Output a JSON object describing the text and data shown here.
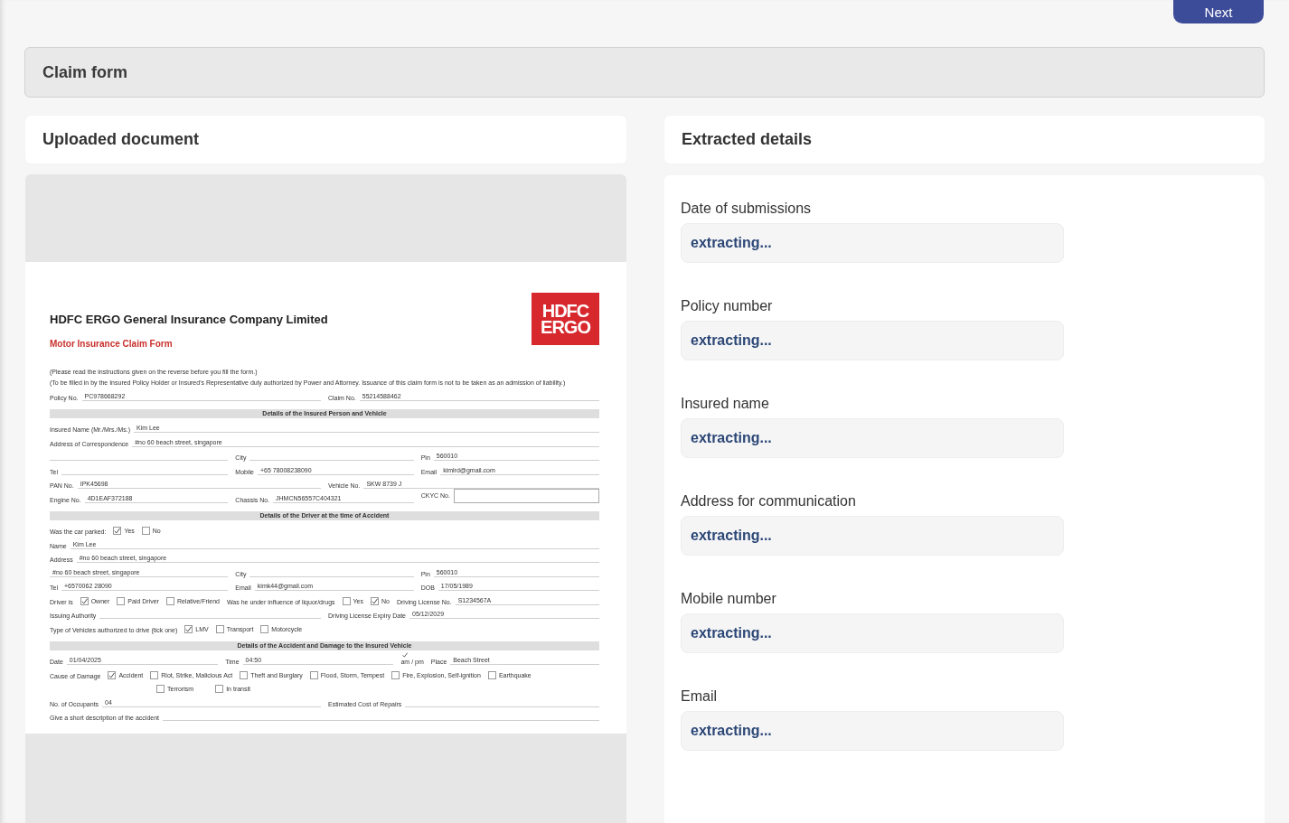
{
  "top_bar": {
    "next_button": "Next"
  },
  "claim_bar": {
    "title": "Claim form"
  },
  "left_panel": {
    "title": "Uploaded document"
  },
  "document": {
    "company": "HDFC ERGO General Insurance Company Limited",
    "logo": "HDFC ERGO",
    "form_title": "Motor Insurance Claim Form",
    "notes": [
      "(Please read the instructions given on the reverse before you fill the form.)",
      "(To be filled in by the Insured Policy Holder or Insured's Representative duly authorized by Power and Attorney. Issuance of this claim form is not to be taken as an admission of liability.)"
    ],
    "top_fields": {
      "items": [
        {
          "kind": "field",
          "label": "Policy No.",
          "value": "PC978668292"
        },
        {
          "kind": "field",
          "label": "Claim No.",
          "value": "55214588462"
        }
      ]
    },
    "sections": [
      {
        "title": "Details of the Insured Person and Vehicle",
        "lines": [
          {
            "items": [
              {
                "kind": "field",
                "label": "Insured Name (Mr./Mrs./Ms.)",
                "value": "Kim Lee"
              }
            ]
          },
          {
            "items": [
              {
                "kind": "field",
                "label": "Address of Correspondence",
                "value": "#no 60 beach street, singapore"
              }
            ]
          },
          {
            "items": [
              {
                "kind": "field"
              },
              {
                "kind": "field",
                "label": "City"
              },
              {
                "kind": "field",
                "label": "Pin",
                "value": "560010"
              }
            ]
          },
          {
            "items": [
              {
                "kind": "field",
                "label": "Tel"
              },
              {
                "kind": "field",
                "label": "Mobile",
                "value": "+65 78008238090"
              },
              {
                "kind": "field",
                "label": "Email",
                "value": "kimlrd@gmail.com"
              }
            ]
          },
          {
            "items": [
              {
                "kind": "field",
                "label": "PAN No.",
                "value": "IPK45698"
              },
              {
                "kind": "field",
                "label": "Vehicle No.",
                "value": "SKW 8739 J"
              }
            ]
          },
          {
            "items": [
              {
                "kind": "field",
                "label": "Engine No.",
                "value": "4D1EAF372188"
              },
              {
                "kind": "field",
                "label": "Chassis No.",
                "value": "JHMCN56557C404321"
              },
              {
                "kind": "box",
                "label": "CKYC No."
              }
            ]
          }
        ]
      },
      {
        "title": "Details of the Driver at the time of Accident",
        "lines": [
          {
            "items": [
              {
                "kind": "label",
                "label": "Was the car parked:"
              },
              {
                "kind": "check",
                "label": "Yes",
                "checked": true
              },
              {
                "kind": "check",
                "label": "No",
                "checked": false
              }
            ]
          },
          {
            "items": [
              {
                "kind": "field",
                "label": "Name",
                "value": "Kim Lee"
              }
            ]
          },
          {
            "items": [
              {
                "kind": "field",
                "label": "Address",
                "value": "#no 60 beach street, singapore"
              }
            ]
          },
          {
            "items": [
              {
                "kind": "field",
                "value": "#no 60 beach street, singapore"
              },
              {
                "kind": "field",
                "label": "City"
              },
              {
                "kind": "field",
                "label": "Pin",
                "value": "560010"
              }
            ]
          },
          {
            "items": [
              {
                "kind": "field",
                "label": "Tel",
                "value": "+6570062 28090"
              },
              {
                "kind": "field",
                "label": "Email",
                "value": "kimk44@gmail.com"
              },
              {
                "kind": "field",
                "label": "DOB",
                "value": "17/05/1989"
              }
            ]
          },
          {
            "items": [
              {
                "kind": "label",
                "label": "Driver is"
              },
              {
                "kind": "check",
                "label": "Owner",
                "checked": true
              },
              {
                "kind": "check",
                "label": "Paid Driver",
                "checked": false
              },
              {
                "kind": "check",
                "label": "Relative/Friend",
                "checked": false
              },
              {
                "kind": "label",
                "label": "Was he under influence of liquor/drugs"
              },
              {
                "kind": "check",
                "label": "Yes",
                "checked": false
              },
              {
                "kind": "check",
                "label": "No",
                "checked": true
              },
              {
                "kind": "field",
                "label": "Driving License No.",
                "value": "S1234567A"
              }
            ]
          },
          {
            "items": [
              {
                "kind": "field",
                "label": "Issuing Authority"
              },
              {
                "kind": "field",
                "label": "Driving License Expiry Date",
                "value": "05/12/2029"
              }
            ]
          },
          {
            "items": [
              {
                "kind": "label",
                "label": "Type of Vehicles authorized to drive (tick one)"
              },
              {
                "kind": "check",
                "label": "LMV",
                "checked": true
              },
              {
                "kind": "check",
                "label": "Transport",
                "checked": false
              },
              {
                "kind": "check",
                "label": "Motorcycle",
                "checked": false
              }
            ]
          }
        ]
      },
      {
        "title": "Details of the Accident and Damage to the Insured Vehicle",
        "lines": [
          {
            "items": [
              {
                "kind": "field",
                "label": "Date",
                "value": "01/04/2025"
              },
              {
                "kind": "field",
                "label": "Time",
                "value": "04:50"
              },
              {
                "kind": "tick_text",
                "label": "am / pm",
                "checked": true
              },
              {
                "kind": "field",
                "label": "Place",
                "value": "Beach Street"
              }
            ]
          },
          {
            "items": [
              {
                "kind": "label",
                "label": "Cause of Damage"
              },
              {
                "kind": "check",
                "label": "Accident",
                "checked": true
              },
              {
                "kind": "check",
                "label": "Riot, Strike, Malicious Act",
                "checked": false
              },
              {
                "kind": "check",
                "label": "Theft and Burglary",
                "checked": false
              },
              {
                "kind": "check",
                "label": "Flood, Storm, Tempest",
                "checked": false
              },
              {
                "kind": "check",
                "label": "Fire, Explosion, Self-ignition",
                "checked": false
              },
              {
                "kind": "check",
                "label": "Earthquake",
                "checked": false
              }
            ]
          },
          {
            "items": [
              {
                "kind": "check",
                "label": "Terrorism",
                "checked": false
              },
              {
                "kind": "check",
                "label": "In transit",
                "checked": false
              }
            ]
          },
          {
            "items": [
              {
                "kind": "field",
                "label": "No. of Occupants",
                "value": "04"
              },
              {
                "kind": "field",
                "label": "Estimated Cost of Repairs"
              }
            ]
          },
          {
            "items": [
              {
                "kind": "field",
                "label": "Give a short description of the accident"
              }
            ]
          }
        ]
      }
    ]
  },
  "right_panel": {
    "title": "Extracted details",
    "fields": [
      {
        "label": "Date of submissions",
        "value": "extracting..."
      },
      {
        "label": "Policy number",
        "value": "extracting..."
      },
      {
        "label": "Insured name",
        "value": "extracting..."
      },
      {
        "label": "Address for communication",
        "value": "extracting..."
      },
      {
        "label": "Mobile number",
        "value": "extracting..."
      },
      {
        "label": "Email",
        "value": "extracting..."
      }
    ]
  }
}
